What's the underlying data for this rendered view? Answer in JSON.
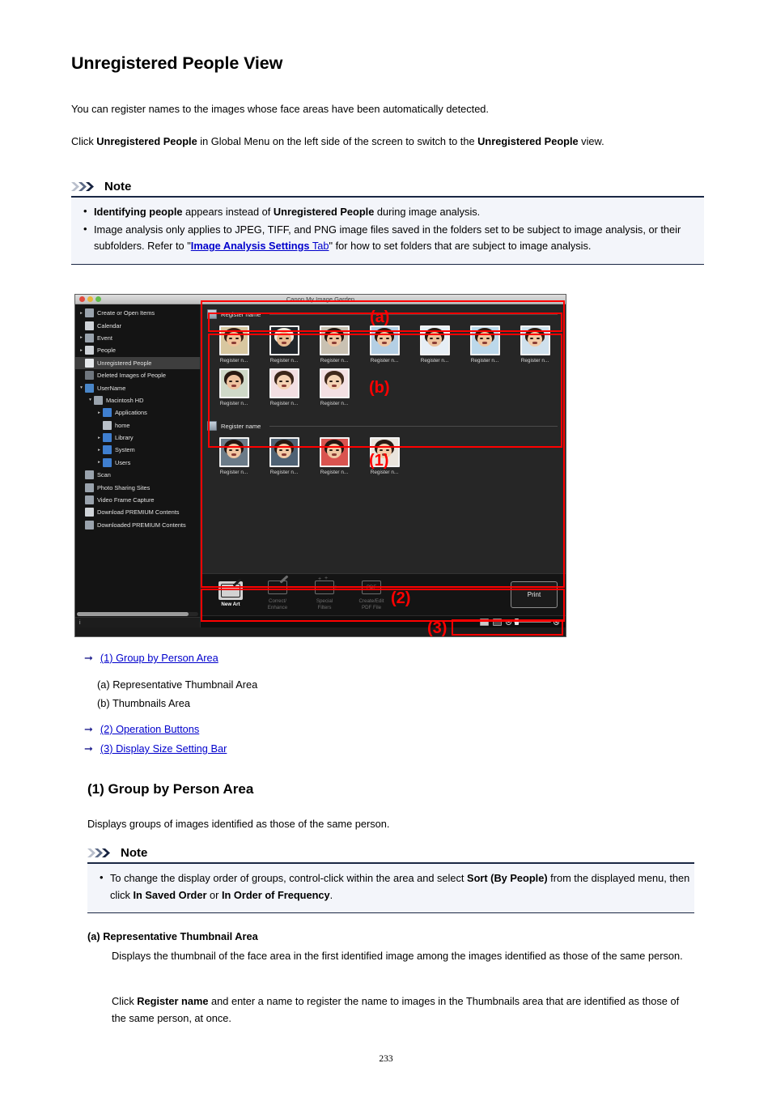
{
  "document": {
    "title": "Unregistered People View",
    "intro": "You can register names to the images whose face areas have been automatically detected.",
    "click_line": {
      "pre": "Click ",
      "bold1": "Unregistered People",
      "mid": " in Global Menu on the left side of the screen to switch to the ",
      "bold2": "Unregistered People",
      "post": " view."
    },
    "page_number": "233"
  },
  "note1": {
    "heading": "Note",
    "items": [
      {
        "bold1": "Identifying people",
        "mid": " appears instead of ",
        "bold2": "Unregistered People",
        "post": " during image analysis."
      },
      {
        "pre": "Image analysis only applies to JPEG, TIFF, and PNG image files saved in the folders set to be subject to image analysis, or their subfolders. Refer to \"",
        "link": "Image Analysis Settings",
        "link_tail": " Tab",
        "post": "\" for how to set folders that are subject to image analysis."
      }
    ]
  },
  "screenshot": {
    "window_title": "Canon My Image Garden",
    "sidebar": {
      "items": [
        {
          "label": "Create or Open Items",
          "twisty": "▸",
          "indent": 0,
          "icon": "create-open-items-icon",
          "selected": false
        },
        {
          "label": "Calendar",
          "twisty": "",
          "indent": 0,
          "icon": "calendar-icon",
          "selected": false
        },
        {
          "label": "Event",
          "twisty": "▸",
          "indent": 0,
          "icon": "event-icon",
          "selected": false
        },
        {
          "label": "People",
          "twisty": "▸",
          "indent": 0,
          "icon": "people-icon",
          "selected": false
        },
        {
          "label": "Unregistered People",
          "twisty": "",
          "indent": 0,
          "icon": "unregistered-people-icon",
          "selected": true
        },
        {
          "label": "Deleted Images of People",
          "twisty": "",
          "indent": 0,
          "icon": "deleted-people-icon",
          "selected": false
        },
        {
          "label": "UserName",
          "twisty": "▾",
          "indent": 0,
          "icon": "computer-icon",
          "selected": false
        },
        {
          "label": "Macintosh HD",
          "twisty": "▾",
          "indent": 1,
          "icon": "harddisk-icon",
          "selected": false
        },
        {
          "label": "Applications",
          "twisty": "▸",
          "indent": 2,
          "icon": "folder-icon",
          "selected": false
        },
        {
          "label": "home",
          "twisty": "",
          "indent": 2,
          "icon": "home-icon",
          "selected": false
        },
        {
          "label": "Library",
          "twisty": "▸",
          "indent": 2,
          "icon": "folder-icon",
          "selected": false
        },
        {
          "label": "System",
          "twisty": "▸",
          "indent": 2,
          "icon": "folder-icon",
          "selected": false
        },
        {
          "label": "Users",
          "twisty": "▸",
          "indent": 2,
          "icon": "folder-icon",
          "selected": false
        },
        {
          "label": "Scan",
          "twisty": "",
          "indent": 0,
          "icon": "scanner-icon",
          "selected": false
        },
        {
          "label": "Photo Sharing Sites",
          "twisty": "",
          "indent": 0,
          "icon": "photo-sharing-icon",
          "selected": false
        },
        {
          "label": "Video Frame Capture",
          "twisty": "",
          "indent": 0,
          "icon": "video-frame-icon",
          "selected": false
        },
        {
          "label": "Download PREMIUM Contents",
          "twisty": "",
          "indent": 0,
          "icon": "download-premium-icon",
          "selected": false
        },
        {
          "label": "Downloaded PREMIUM Contents",
          "twisty": "",
          "indent": 0,
          "icon": "downloaded-premium-icon",
          "selected": false
        }
      ],
      "status_text": "i"
    },
    "groups": [
      {
        "header_label": "Register name",
        "thumbnails": [
          {
            "caption": "Register n...",
            "hair": "#3a2014",
            "skin": "#f0c49c",
            "shirt": "#d8c7a0"
          },
          {
            "caption": "Register n...",
            "hair": "#efe9dc",
            "skin": "#e8bb92",
            "shirt": "#21262b"
          },
          {
            "caption": "Register n...",
            "hair": "#241710",
            "skin": "#eec5a2",
            "shirt": "#c9c1b2"
          },
          {
            "caption": "Register n...",
            "hair": "#2a1a10",
            "skin": "#f1c8a4",
            "shirt": "#b4cfe4"
          },
          {
            "caption": "Register n...",
            "hair": "#271810",
            "skin": "#edc29c",
            "shirt": "#e6eef5"
          },
          {
            "caption": "Register n...",
            "hair": "#2b1a11",
            "skin": "#f0c6a0",
            "shirt": "#bcd8ea"
          },
          {
            "caption": "Register n...",
            "hair": "#2d1c12",
            "skin": "#f2cba7",
            "shirt": "#cfe0ec"
          },
          {
            "caption": "Register n...",
            "hair": "#281911",
            "skin": "#eec3a0",
            "shirt": "#cfd9c8"
          },
          {
            "caption": "Register n...",
            "hair": "#3b261a",
            "skin": "#f4d2b4",
            "shirt": "#f2dfe2"
          },
          {
            "caption": "Register n...",
            "hair": "#40291c",
            "skin": "#f5d4b6",
            "shirt": "#f3e0e3"
          }
        ]
      },
      {
        "header_label": "Register name",
        "thumbnails": [
          {
            "caption": "Register n...",
            "hair": "#241610",
            "skin": "#f0c6a2",
            "shirt": "#6b7b88"
          },
          {
            "caption": "Register n...",
            "hair": "#271810",
            "skin": "#f2caa6",
            "shirt": "#4f6274"
          },
          {
            "caption": "Register n...",
            "hair": "#231510",
            "skin": "#f0c7a3",
            "shirt": "#d9534f"
          },
          {
            "caption": "Register n...",
            "hair": "#2a1a12",
            "skin": "#f3cdaa",
            "shirt": "#e9e4dc"
          }
        ]
      }
    ],
    "operation_buttons": [
      {
        "label": "New Art",
        "icon": "new-art-icon",
        "active": true
      },
      {
        "label": "Correct/\nEnhance",
        "icon": "correct-enhance-icon",
        "active": false
      },
      {
        "label": "Special\nFilters",
        "icon": "special-filters-icon",
        "active": false
      },
      {
        "label": "Create/Edit\nPDF File",
        "icon": "create-edit-pdf-icon",
        "active": false
      }
    ],
    "print_button": "Print",
    "annotations": {
      "a": "(a)",
      "b": "(b)",
      "one": "(1)",
      "two": "(2)",
      "three": "(3)"
    },
    "accent_color": "#ff0000"
  },
  "links": [
    {
      "label": "(1) Group by Person Area"
    },
    {
      "label": "(2) Operation Buttons"
    },
    {
      "label": "(3) Display Size Setting Bar"
    }
  ],
  "sublabels": [
    "(a) Representative Thumbnail Area",
    "(b) Thumbnails Area"
  ],
  "section1": {
    "heading": "(1) Group by Person Area",
    "body": "Displays groups of images identified as those of the same person."
  },
  "note2": {
    "heading": "Note",
    "item": {
      "pre": "To change the display order of groups, control-click within the area and select ",
      "bold1": "Sort (By People)",
      "mid": " from the displayed menu, then click ",
      "bold2": "In Saved Order",
      "mid2": " or ",
      "bold3": "In Order of Frequency",
      "post": "."
    }
  },
  "section_a": {
    "heading": "(a) Representative Thumbnail Area",
    "para1": "Displays the thumbnail of the face area in the first identified image among the images identified as those of the same person.",
    "para2": {
      "pre": "Click ",
      "bold": "Register name",
      "post": " and enter a name to register the name to images in the Thumbnails area that are identified as those of the same person, at once."
    }
  }
}
